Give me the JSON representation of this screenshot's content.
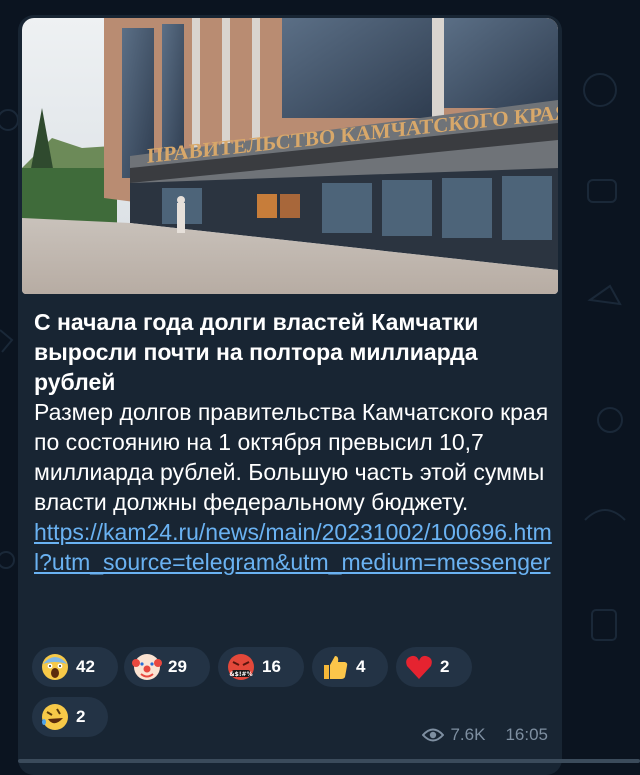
{
  "post": {
    "image_sign_text": "ПРАВИТЕЛЬСТВО КАМЧАТСКОГО КРАЯ",
    "title_line": "С начала года долги властей Камчатки выросли почти на полтора миллиарда рублей",
    "body_text": "Размер долгов правительства Камчатского края по состоянию на 1 октября превысил 10,7 миллиарда рублей. Большую часть этой суммы власти должны федеральному бюджету.",
    "link_text": "https://kam24.ru/news/main/20231002/100696.html?utm_source=telegram&utm_medium=messenger"
  },
  "reactions": [
    {
      "icon": "scream-emoji-icon",
      "count": "42"
    },
    {
      "icon": "clown-emoji-icon",
      "count": "29"
    },
    {
      "icon": "cursing-face-emoji-icon",
      "count": "16"
    },
    {
      "icon": "thumbs-up-emoji-icon",
      "count": "4"
    },
    {
      "icon": "red-heart-emoji-icon",
      "count": "2"
    },
    {
      "icon": "rofl-emoji-icon",
      "count": "2"
    }
  ],
  "meta": {
    "views": "7.6K",
    "time": "16:05"
  },
  "colors": {
    "bubble": "#182533",
    "link": "#6ab2f2",
    "meta": "#7e8fa1",
    "reaction_bg": "#233345"
  }
}
